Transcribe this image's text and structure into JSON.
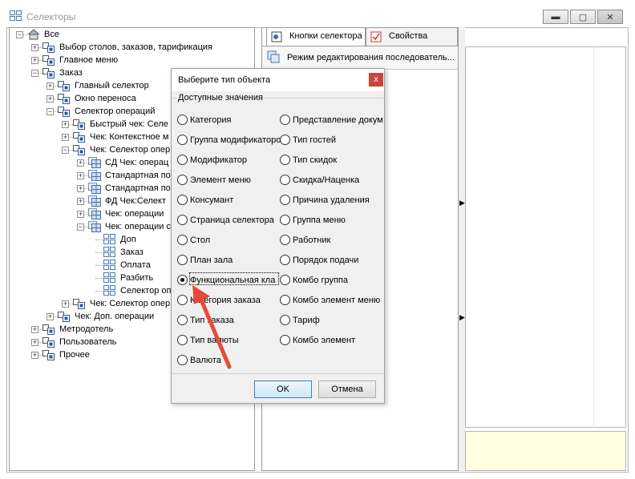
{
  "window": {
    "title": "Селекторы"
  },
  "tree": {
    "items": [
      {
        "label": "Все"
      },
      {
        "label": "Выбор столов, заказов, тарификация"
      },
      {
        "label": "Главное меню"
      },
      {
        "label": "Заказ"
      },
      {
        "label": "Главный селектор"
      },
      {
        "label": "Окно переноса"
      },
      {
        "label": "Селектор операций"
      },
      {
        "label": "Быстрый чек: Селе"
      },
      {
        "label": "Чек: Контекстное м"
      },
      {
        "label": "Чек: Селектор опер"
      },
      {
        "label": "СД Чек: операц"
      },
      {
        "label": "Стандартная по"
      },
      {
        "label": "Стандартная по"
      },
      {
        "label": "ФД Чек:Селект"
      },
      {
        "label": "Чек: операции"
      },
      {
        "label": "Чек: операции с"
      },
      {
        "label": "Доп"
      },
      {
        "label": "Заказ"
      },
      {
        "label": "Оплата"
      },
      {
        "label": "Разбить"
      },
      {
        "label": "Селектор оп"
      },
      {
        "label": "Чек: Селектор опер"
      },
      {
        "label": "Чек: Доп. операции"
      },
      {
        "label": "Метродотель"
      },
      {
        "label": "Пользователь"
      },
      {
        "label": "Прочее"
      }
    ]
  },
  "tabs": [
    {
      "label": "Кнопки селектора"
    },
    {
      "label": "Свойства"
    }
  ],
  "mode_label": "Режим редактирования последователь...",
  "dialog": {
    "title": "Выберите тип объекта",
    "close": "x",
    "group_label": "Доступные значения",
    "left_options": [
      {
        "label": "Категория"
      },
      {
        "label": "Группа модификаторо"
      },
      {
        "label": "Модификатор"
      },
      {
        "label": "Элемент меню"
      },
      {
        "label": "Консумант"
      },
      {
        "label": "Страница селектора"
      },
      {
        "label": "Стол"
      },
      {
        "label": "План зала"
      },
      {
        "label": "Функциональная кла"
      },
      {
        "label": "Категория заказа"
      },
      {
        "label": "Тип заказа"
      },
      {
        "label": "Тип валюты"
      },
      {
        "label": "Валюта"
      }
    ],
    "right_options": [
      {
        "label": "Представление докум"
      },
      {
        "label": "Тип гостей"
      },
      {
        "label": "Тип скидок"
      },
      {
        "label": "Скидка/Наценка"
      },
      {
        "label": "Причина удаления"
      },
      {
        "label": "Группа меню"
      },
      {
        "label": "Работник"
      },
      {
        "label": "Порядок подачи"
      },
      {
        "label": "Комбо группа"
      },
      {
        "label": "Комбо элемент меню"
      },
      {
        "label": "Тариф"
      },
      {
        "label": "Комбо элемент"
      }
    ],
    "selected": "Функциональная кла",
    "ok": "OK",
    "cancel": "Отмена"
  },
  "colors": {
    "annotation_arrow": "#e8483a",
    "note_bg": "#fffee0"
  }
}
